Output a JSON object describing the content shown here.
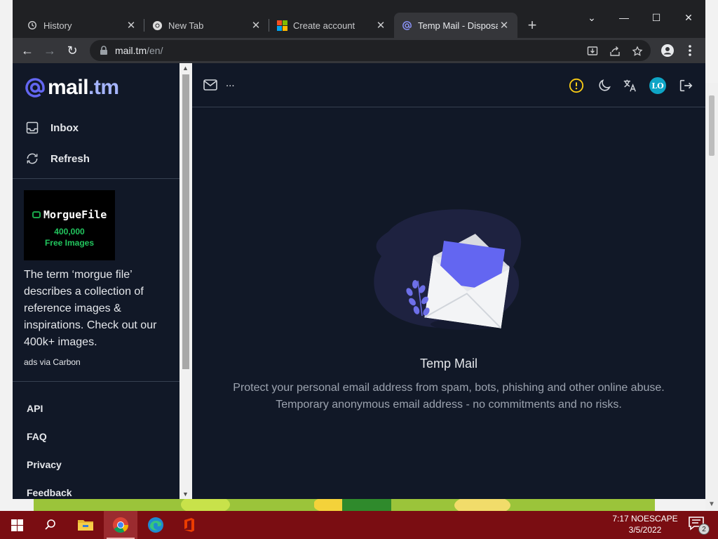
{
  "browser": {
    "tabs": [
      {
        "title": "History",
        "favicon": "history-icon"
      },
      {
        "title": "New Tab",
        "favicon": "chrome-icon"
      },
      {
        "title": "Create account",
        "favicon": "microsoft-icon"
      },
      {
        "title": "Temp Mail - Disposal",
        "favicon": "at-sign-icon",
        "active": true
      }
    ],
    "new_tab_label": "+",
    "window_controls": {
      "dropdown": "⌄",
      "minimize": "—",
      "maximize": "☐",
      "close": "✕"
    },
    "address": {
      "host": "mail.tm",
      "path": "/en/"
    },
    "nav": {
      "back": "←",
      "forward": "→",
      "reload": "↻"
    }
  },
  "sidebar": {
    "logo": {
      "name": "mail",
      "tld": ".tm"
    },
    "items": [
      {
        "label": "Inbox",
        "icon": "inbox-icon"
      },
      {
        "label": "Refresh",
        "icon": "refresh-icon"
      }
    ],
    "ad": {
      "brand": "MorgueFile",
      "count": "400,000",
      "tagline": "Free Images",
      "text": "The term ‘morgue file’ describes a collection of reference images & inspirations. Check out our 400k+ images.",
      "via": "ads via Carbon"
    },
    "footer_links": [
      "API",
      "FAQ",
      "Privacy",
      "Feedback"
    ]
  },
  "main": {
    "header": {
      "address_placeholder": "...",
      "avatar_initials": "LO"
    },
    "empty_state": {
      "title": "Temp Mail",
      "line1": "Protect your personal email address from spam, bots, phishing and other online abuse.",
      "line2": "Temporary anonymous email address - no commitments and no risks."
    }
  },
  "taskbar": {
    "clock_time": "7:17 NOESCAPE",
    "clock_date": "3/5/2022",
    "notification_count": "2"
  },
  "colors": {
    "accent": "#6366f1",
    "sidebar_bg": "#111827",
    "taskbar_bg": "#7a0d12",
    "warning": "#facc15",
    "avatar": "#0ea5c6"
  }
}
